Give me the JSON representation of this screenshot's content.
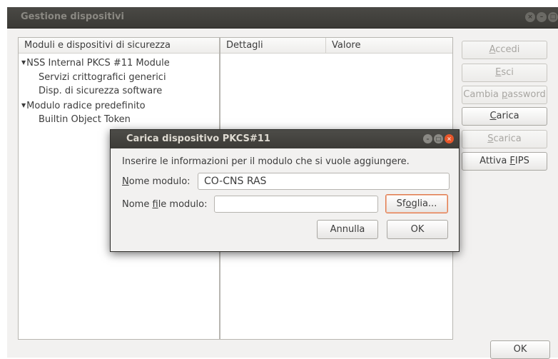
{
  "window": {
    "title": "Gestione dispositivi",
    "controls": [
      "close-icon",
      "minimize-icon",
      "maximize-icon"
    ]
  },
  "left_pane": {
    "header": "Moduli e dispositivi di sicurezza",
    "tree": [
      {
        "label": "NSS Internal PKCS #11 Module",
        "expanded": true
      },
      {
        "label": "Servizi crittografici generici"
      },
      {
        "label": "Disp. di sicurezza software"
      },
      {
        "label": "Modulo radice predefinito",
        "expanded": true
      },
      {
        "label": "Builtin Object Token"
      }
    ]
  },
  "details_pane": {
    "col_details": "Dettagli",
    "col_value": "Valore"
  },
  "side_buttons": {
    "login_pre": "",
    "login_u": "A",
    "login_post": "ccedi",
    "logout_pre": "",
    "logout_u": "E",
    "logout_post": "sci",
    "change_pw_pre": "Cambia ",
    "change_pw_u": "p",
    "change_pw_post": "assword",
    "load_pre": "",
    "load_u": "C",
    "load_post": "arica",
    "unload_pre": "",
    "unload_u": "S",
    "unload_post": "carica",
    "fips_pre": "Attiva ",
    "fips_u": "F",
    "fips_post": "IPS"
  },
  "ok_label": "OK",
  "dialog": {
    "title": "Carica dispositivo PKCS#11",
    "message": "Inserire le informazioni per il modulo che si vuole aggiungere.",
    "module_name_label_u": "N",
    "module_name_label_post": "ome modulo:",
    "module_name_value": "CO-CNS RAS",
    "module_file_label_pre": "Nome ",
    "module_file_label_u": "f",
    "module_file_label_post": "ile modulo:",
    "module_file_value": "",
    "browse_pre": "Sf",
    "browse_u": "o",
    "browse_post": "glia...",
    "cancel_label": "Annulla",
    "ok_label": "OK",
    "accent": "#e8562a"
  }
}
